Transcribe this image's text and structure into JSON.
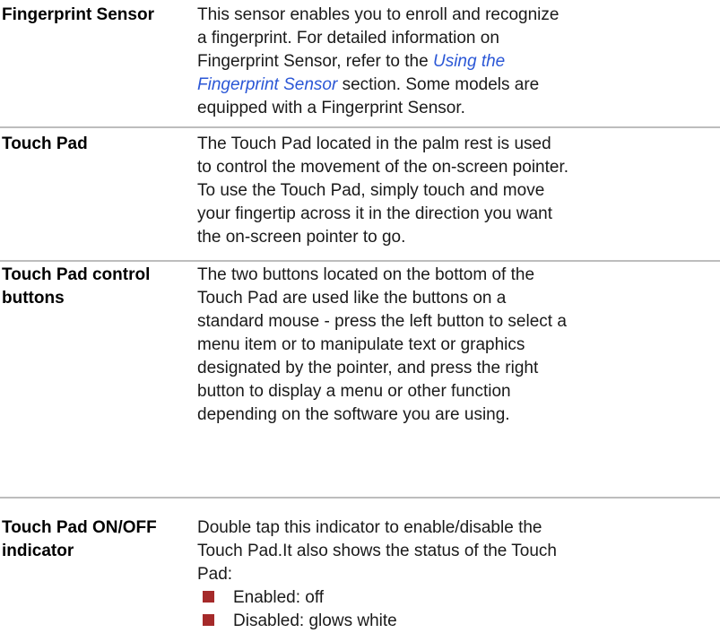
{
  "rows": [
    {
      "term_lines": [
        "Fingerprint Sensor"
      ],
      "desc_lines": [
        "This sensor enables you to enroll and recognize",
        "a fingerprint. For detailed information on",
        {
          "pre": "Fingerprint Sensor, refer to the ",
          "link": "Using the",
          "post": ""
        },
        {
          "pre": "",
          "link": "Fingerprint Sensor",
          "post": " section. Some models are"
        },
        "equipped with a Fingerprint Sensor."
      ]
    },
    {
      "term_lines": [
        "Touch Pad"
      ],
      "desc_lines": [
        "The Touch Pad located in the palm rest is used",
        "to control the movement of the on-screen pointer.",
        "To use the Touch Pad, simply touch and move",
        "your fingertip across it in the direction you want",
        "the on-screen pointer to go."
      ]
    },
    {
      "term_lines": [
        "Touch Pad control",
        "buttons"
      ],
      "desc_lines": [
        "The two buttons located on the bottom of the",
        "Touch Pad are used like the buttons on a",
        "standard mouse - press the left button to select a",
        "menu item or to manipulate text or graphics",
        "designated by the pointer, and press the right",
        "button to display a menu or other function",
        "depending on the software you are using."
      ]
    },
    {
      "term_lines": [
        "Touch Pad ON/OFF",
        "indicator"
      ],
      "desc_lines": [
        "Double tap this indicator to enable/disable the",
        "Touch Pad.It also shows the status of the Touch",
        "Pad:"
      ],
      "bullets": [
        "Enabled: off",
        "Disabled: glows white"
      ]
    }
  ],
  "colors": {
    "link": "#2b57d6",
    "bullet": "#a52a2a",
    "divider": "#bdbdbd"
  }
}
